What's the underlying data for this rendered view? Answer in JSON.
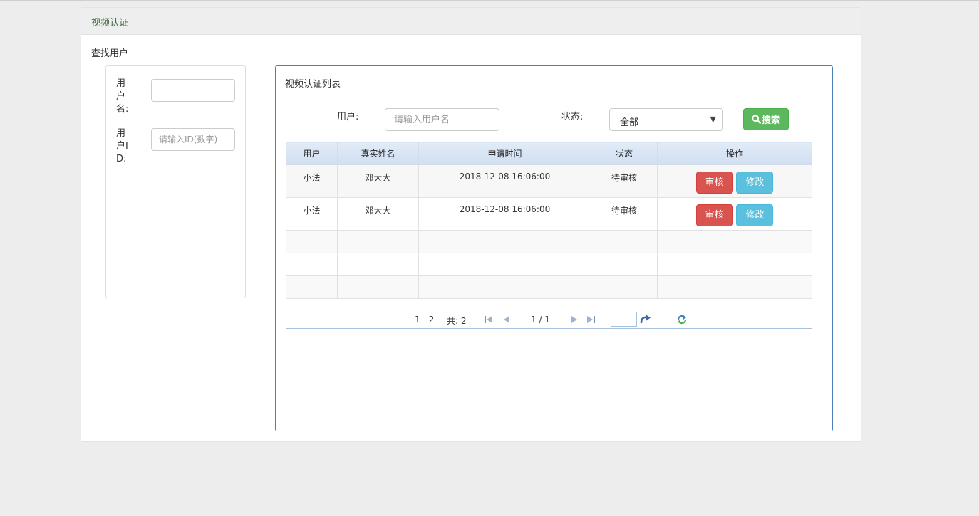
{
  "panel": {
    "title": "视频认证",
    "find_user_label": "查找用户"
  },
  "left_form": {
    "username_label": "用户名:",
    "username_value": "",
    "userid_label": "用户ID:",
    "userid_placeholder": "请输入ID(数字)"
  },
  "list": {
    "title": "视频认证列表",
    "filter": {
      "user_label": "用户:",
      "user_placeholder": "请输入用户名",
      "status_label": "状态:",
      "status_selected": "全部",
      "search_label": "搜索"
    },
    "columns": [
      "用户",
      "真实姓名",
      "申请时间",
      "状态",
      "操作"
    ],
    "rows": [
      {
        "user": "小法",
        "real_name": "邓大大",
        "apply_time": "2018-12-08 16:06:00",
        "status": "待审核",
        "review_label": "审核",
        "edit_label": "修改"
      },
      {
        "user": "小法",
        "real_name": "邓大大",
        "apply_time": "2018-12-08 16:06:00",
        "status": "待审核",
        "review_label": "审核",
        "edit_label": "修改"
      }
    ],
    "pager": {
      "range": "1 - 2",
      "total": "共: 2",
      "page": "1 / 1",
      "jump_value": ""
    }
  },
  "colors": {
    "heading_text": "#3c6e3c",
    "success": "#5cb85c",
    "danger": "#d9534f",
    "info": "#5bc0de",
    "box_border": "#4a7fb5"
  },
  "icons": {
    "search": "search-icon",
    "first": "first-page-icon",
    "prev": "prev-page-icon",
    "next": "next-page-icon",
    "last": "last-page-icon",
    "go": "go-arrow-icon",
    "refresh": "refresh-icon"
  }
}
